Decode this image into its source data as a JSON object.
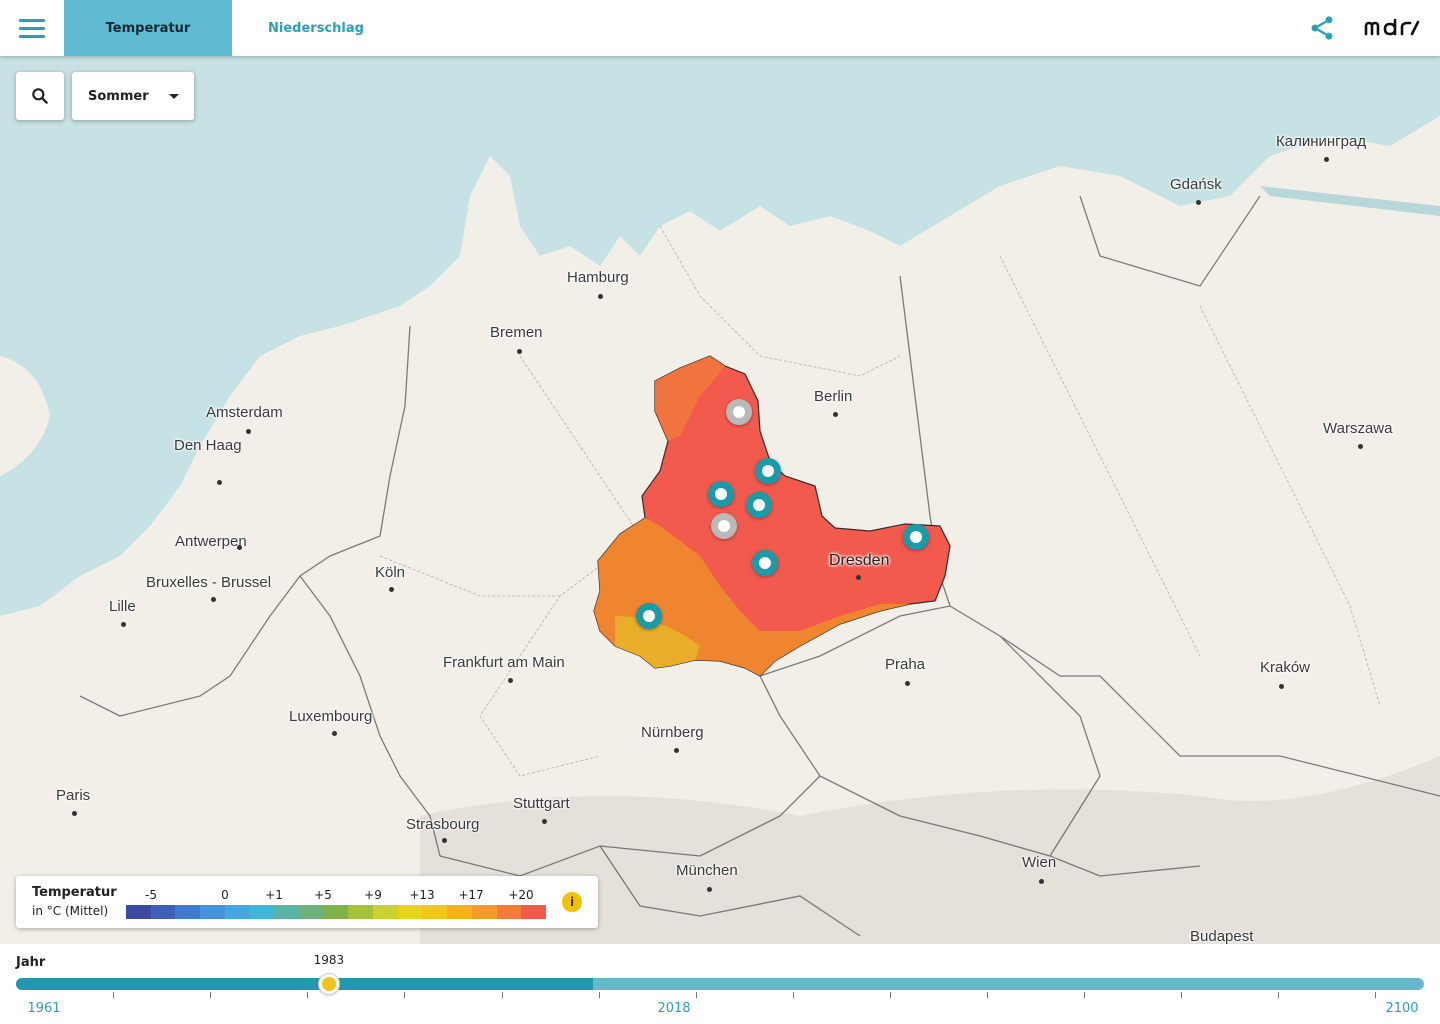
{
  "header": {
    "tabs": [
      {
        "label": "Temperatur",
        "active": true
      },
      {
        "label": "Niederschlag",
        "active": false
      }
    ],
    "logo_text": "mdr",
    "menu_icon": "hamburger-menu-icon",
    "share_icon": "share-icon"
  },
  "controls": {
    "search_icon": "search-icon",
    "season": "Sommer"
  },
  "map": {
    "cities": [
      {
        "name": "Калининград"
      },
      {
        "name": "Gdańsk"
      },
      {
        "name": "Hamburg"
      },
      {
        "name": "Bremen"
      },
      {
        "name": "Berlin"
      },
      {
        "name": "Amsterdam"
      },
      {
        "name": "Den Haag"
      },
      {
        "name": "Warszawa"
      },
      {
        "name": "Antwerpen"
      },
      {
        "name": "Bruxelles - Brussel"
      },
      {
        "name": "Köln"
      },
      {
        "name": "Lille"
      },
      {
        "name": "Dresden"
      },
      {
        "name": "Frankfurt am Main"
      },
      {
        "name": "Praha"
      },
      {
        "name": "Kraków"
      },
      {
        "name": "Luxembourg"
      },
      {
        "name": "Nürnberg"
      },
      {
        "name": "Paris"
      },
      {
        "name": "Stuttgart"
      },
      {
        "name": "Strasbourg"
      },
      {
        "name": "München"
      },
      {
        "name": "Wien"
      },
      {
        "name": "Budapest"
      }
    ],
    "colors": {
      "water": "#c7e2e4",
      "land": "#f2efe9",
      "region_hot": "#f25a4e",
      "region_warm": "#ef8a2e",
      "station_active": "#1b9aa8",
      "station_inactive": "#b9b9b9"
    }
  },
  "legend": {
    "title": "Temperatur",
    "subtitle": "in °C (Mittel)",
    "ticks": [
      "-5",
      "0",
      "+1",
      "+5",
      "+9",
      "+13",
      "+17",
      "+20"
    ],
    "colors": [
      "#3b4aa0",
      "#3e5fb8",
      "#3f7bd0",
      "#4592dc",
      "#45a7e0",
      "#3fb7d8",
      "#5bb3a6",
      "#6fb07c",
      "#7fb24a",
      "#a5c23a",
      "#cbd230",
      "#e6d51f",
      "#f1c51a",
      "#f4b018",
      "#f59a28",
      "#f47c3a",
      "#f35a4c"
    ],
    "info_label": "i"
  },
  "timeline": {
    "label": "Jahr",
    "start_year": "1961",
    "mid_year": "2018",
    "end_year": "2100",
    "current_year": "1983",
    "start": 1961,
    "end": 2100,
    "historic_end": 2018,
    "current": 1983
  }
}
